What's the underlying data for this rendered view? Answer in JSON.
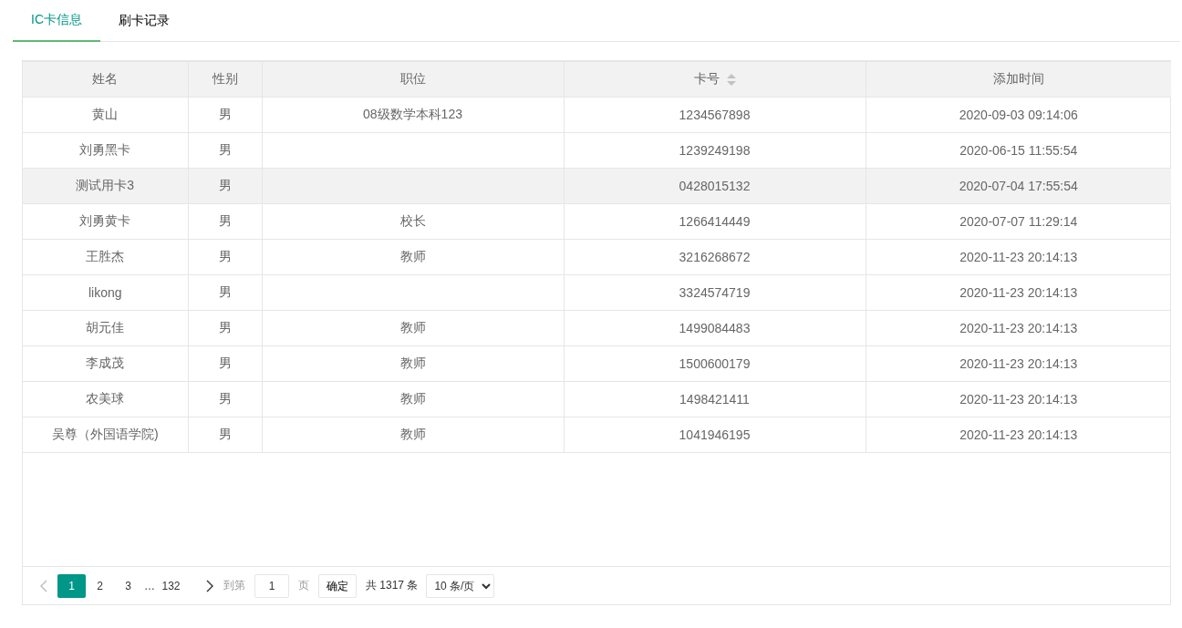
{
  "tabs": [
    {
      "label": "IC卡信息",
      "selected": true
    },
    {
      "label": "刷卡记录",
      "selected": false
    }
  ],
  "table": {
    "columns": [
      {
        "label": "姓名",
        "sortable": false
      },
      {
        "label": "性别",
        "sortable": false
      },
      {
        "label": "职位",
        "sortable": false
      },
      {
        "label": "卡号",
        "sortable": true
      },
      {
        "label": "添加时间",
        "sortable": false
      }
    ],
    "rows": [
      {
        "name": "黄山",
        "gender": "男",
        "position": "08级数学本科123",
        "card_no": "1234567898",
        "added_time": "2020-09-03 09:14:06",
        "highlighted": false
      },
      {
        "name": "刘勇黑卡",
        "gender": "男",
        "card_no": "1239249198",
        "added_time": "2020-06-15 11:55:54",
        "highlighted": false
      },
      {
        "name": "测试用卡3",
        "gender": "男",
        "card_no": "0428015132",
        "added_time": "2020-07-04 17:55:54",
        "highlighted": true
      },
      {
        "name": "刘勇黄卡",
        "gender": "男",
        "position": "校长",
        "card_no": "1266414449",
        "added_time": "2020-07-07 11:29:14",
        "highlighted": false
      },
      {
        "name": "王胜杰",
        "gender": "男",
        "position": "教师",
        "card_no": "3216268672",
        "added_time": "2020-11-23 20:14:13",
        "highlighted": false
      },
      {
        "name": "likong",
        "gender": "男",
        "card_no": "3324574719",
        "added_time": "2020-11-23 20:14:13",
        "highlighted": false
      },
      {
        "name": "胡元佳",
        "gender": "男",
        "position": "教师",
        "card_no": "1499084483",
        "added_time": "2020-11-23 20:14:13",
        "highlighted": false
      },
      {
        "name": "李成茂",
        "gender": "男",
        "position": "教师",
        "card_no": "1500600179",
        "added_time": "2020-11-23 20:14:13",
        "highlighted": false
      },
      {
        "name": "农美球",
        "gender": "男",
        "position": "教师",
        "card_no": "1498421411",
        "added_time": "2020-11-23 20:14:13",
        "highlighted": false
      },
      {
        "name": "吴尊（外国语学院)",
        "gender": "男",
        "position": "教师",
        "card_no": "1041946195",
        "added_time": "2020-11-23 20:14:13",
        "highlighted": false
      }
    ]
  },
  "pager": {
    "prev_disabled": true,
    "next_disabled": false,
    "pages": [
      {
        "label": "1",
        "kind": "page",
        "selected": true
      },
      {
        "label": "2",
        "kind": "page",
        "selected": false
      },
      {
        "label": "3",
        "kind": "page",
        "selected": false
      },
      {
        "label": "…",
        "kind": "ellipsis"
      },
      {
        "label": "132",
        "kind": "page",
        "selected": false
      }
    ],
    "goto_label": "到第",
    "goto_value": "1",
    "page_unit": "页",
    "confirm": "确定",
    "total": "共 1317 条",
    "page_size": "10 条/页"
  }
}
